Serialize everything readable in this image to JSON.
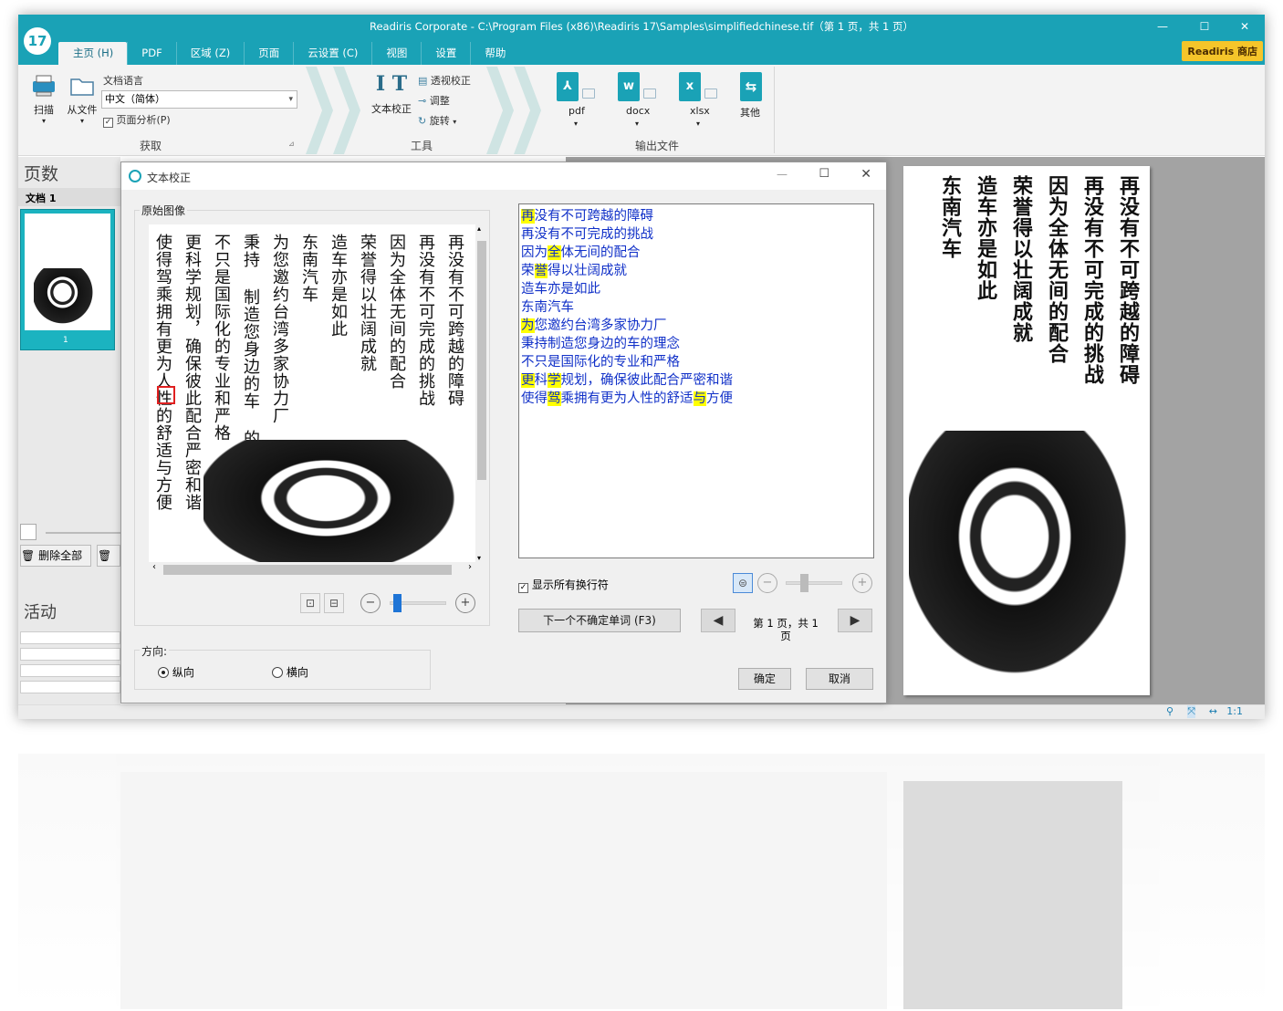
{
  "app": {
    "title": "Readiris Corporate - C:\\Program Files (x86)\\Readiris 17\\Samples\\simplifiedchinese.tif（第 1 页，共 1 页）",
    "logo": "17",
    "store": "Readiris 商店"
  },
  "tabs": [
    "主页 (H)",
    "PDF",
    "区域 (Z)",
    "页面",
    "云设置 (C)",
    "视图",
    "设置",
    "帮助"
  ],
  "ribbon": {
    "scan": "扫描",
    "from_file": "从文件",
    "doc_lang_label": "文档语言",
    "doc_lang_value": "中文（简体）",
    "page_analysis": "页面分析(P)",
    "acquire": "获取",
    "text_correction": "文本校正",
    "perspective": "透视校正",
    "adjust": "调整",
    "rotate": "旋转",
    "tools": "工具",
    "pdf": "pdf",
    "docx": "docx",
    "xlsx": "xlsx",
    "other": "其他",
    "output": "输出文件"
  },
  "left_pane": {
    "pages": "页数",
    "doc": "文档 1",
    "page_no": "1",
    "delete_all": "删除全部",
    "activity": "活动"
  },
  "dialog": {
    "title": "文本校正",
    "original_image": "原始图像",
    "show_line_breaks": "显示所有换行符",
    "next_uncertain": "下一个不确定单词 (F3)",
    "page_info": "第 1 页，共 1 页",
    "direction": "方向:",
    "vertical": "纵向",
    "horizontal": "横向",
    "ok": "确定",
    "cancel": "取消"
  },
  "recognized_lines": [
    [
      {
        "t": "再",
        "h": true
      },
      {
        "t": "没有不可跨越的障碍"
      }
    ],
    [
      {
        "t": "再没有不可完成的挑战"
      }
    ],
    [
      {
        "t": "因为"
      },
      {
        "t": "全",
        "h": true
      },
      {
        "t": "体无间的配合"
      }
    ],
    [
      {
        "t": "荣"
      },
      {
        "t": "誉",
        "h": true
      },
      {
        "t": "得以壮阔成就"
      }
    ],
    [
      {
        "t": "造车亦是如此"
      }
    ],
    [
      {
        "t": "东南汽车"
      }
    ],
    [
      {
        "t": "为",
        "h": true
      },
      {
        "t": "您邀约台湾多家协力厂"
      }
    ],
    [
      {
        "t": "秉持制造您身边的车的理念"
      }
    ],
    [
      {
        "t": "不只是国际化的专业和严格"
      }
    ],
    [
      {
        "t": "更",
        "h": true
      },
      {
        "t": "科"
      },
      {
        "t": "学",
        "h": true
      },
      {
        "t": "规划，确保彼此配合严密和谐"
      }
    ],
    [
      {
        "t": "使得"
      },
      {
        "t": "驾",
        "h": true
      },
      {
        "t": "乘拥有更为人性的舒适"
      },
      {
        "t": "与",
        "h": true
      },
      {
        "t": "方便"
      }
    ]
  ],
  "image_columns": [
    "再没有不可跨越的障碍",
    "再没有不可完成的挑战",
    "因为全体无间的配合",
    "荣誉得以壮阔成就",
    "造车亦是如此",
    "东南汽车",
    "为您邀约台湾多家协力厂",
    "秉持 制造您身边的车 的理念",
    "不只是国际化的专业和严格",
    "更科学规划，确保彼此配合严密和谐",
    "使得驾乘拥有更为人性的舒适与方便"
  ],
  "page_columns": [
    "再没有不可跨越的障碍",
    "再没有不可完成的挑战",
    "因为全体无间的配合",
    "荣誉得以壮阔成就",
    "造车亦是如此",
    "东南汽车"
  ]
}
